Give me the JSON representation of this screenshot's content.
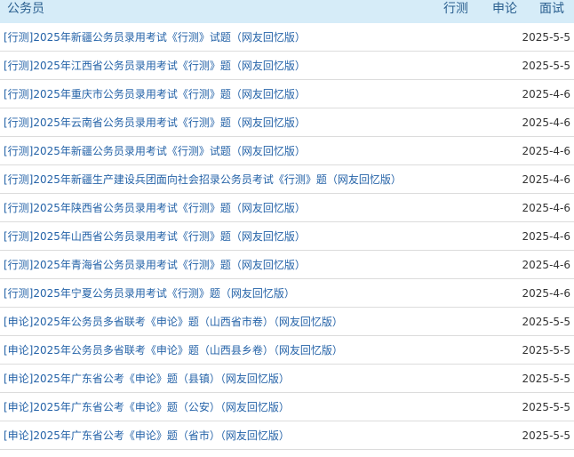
{
  "header": {
    "title": "公务员",
    "tabs": [
      "行测",
      "申论",
      "面试"
    ]
  },
  "items": [
    {
      "title": "[行测]2025年新疆公务员录用考试《行测》试题（网友回忆版）",
      "date": "2025-5-5"
    },
    {
      "title": "[行测]2025年江西省公务员录用考试《行测》题（网友回忆版）",
      "date": "2025-5-5"
    },
    {
      "title": "[行测]2025年重庆市公务员录用考试《行测》题（网友回忆版）",
      "date": "2025-4-6"
    },
    {
      "title": "[行测]2025年云南省公务员录用考试《行测》题（网友回忆版）",
      "date": "2025-4-6"
    },
    {
      "title": "[行测]2025年新疆公务员录用考试《行测》试题（网友回忆版）",
      "date": "2025-4-6"
    },
    {
      "title": "[行测]2025年新疆生产建设兵团面向社会招录公务员考试《行测》题（网友回忆版）",
      "date": "2025-4-6"
    },
    {
      "title": "[行测]2025年陕西省公务员录用考试《行测》题（网友回忆版）",
      "date": "2025-4-6"
    },
    {
      "title": "[行测]2025年山西省公务员录用考试《行测》题（网友回忆版）",
      "date": "2025-4-6"
    },
    {
      "title": "[行测]2025年青海省公务员录用考试《行测》题（网友回忆版）",
      "date": "2025-4-6"
    },
    {
      "title": "[行测]2025年宁夏公务员录用考试《行测》题（网友回忆版）",
      "date": "2025-4-6"
    },
    {
      "title": "[申论]2025年公务员多省联考《申论》题（山西省市卷）（网友回忆版）",
      "date": "2025-5-5"
    },
    {
      "title": "[申论]2025年公务员多省联考《申论》题（山西县乡卷）（网友回忆版）",
      "date": "2025-5-5"
    },
    {
      "title": "[申论]2025年广东省公考《申论》题（县镇）（网友回忆版）",
      "date": "2025-5-5"
    },
    {
      "title": "[申论]2025年广东省公考《申论》题（公安）（网友回忆版）",
      "date": "2025-5-5"
    },
    {
      "title": "[申论]2025年广东省公考《申论》题（省市）（网友回忆版）",
      "date": "2025-5-5"
    }
  ]
}
